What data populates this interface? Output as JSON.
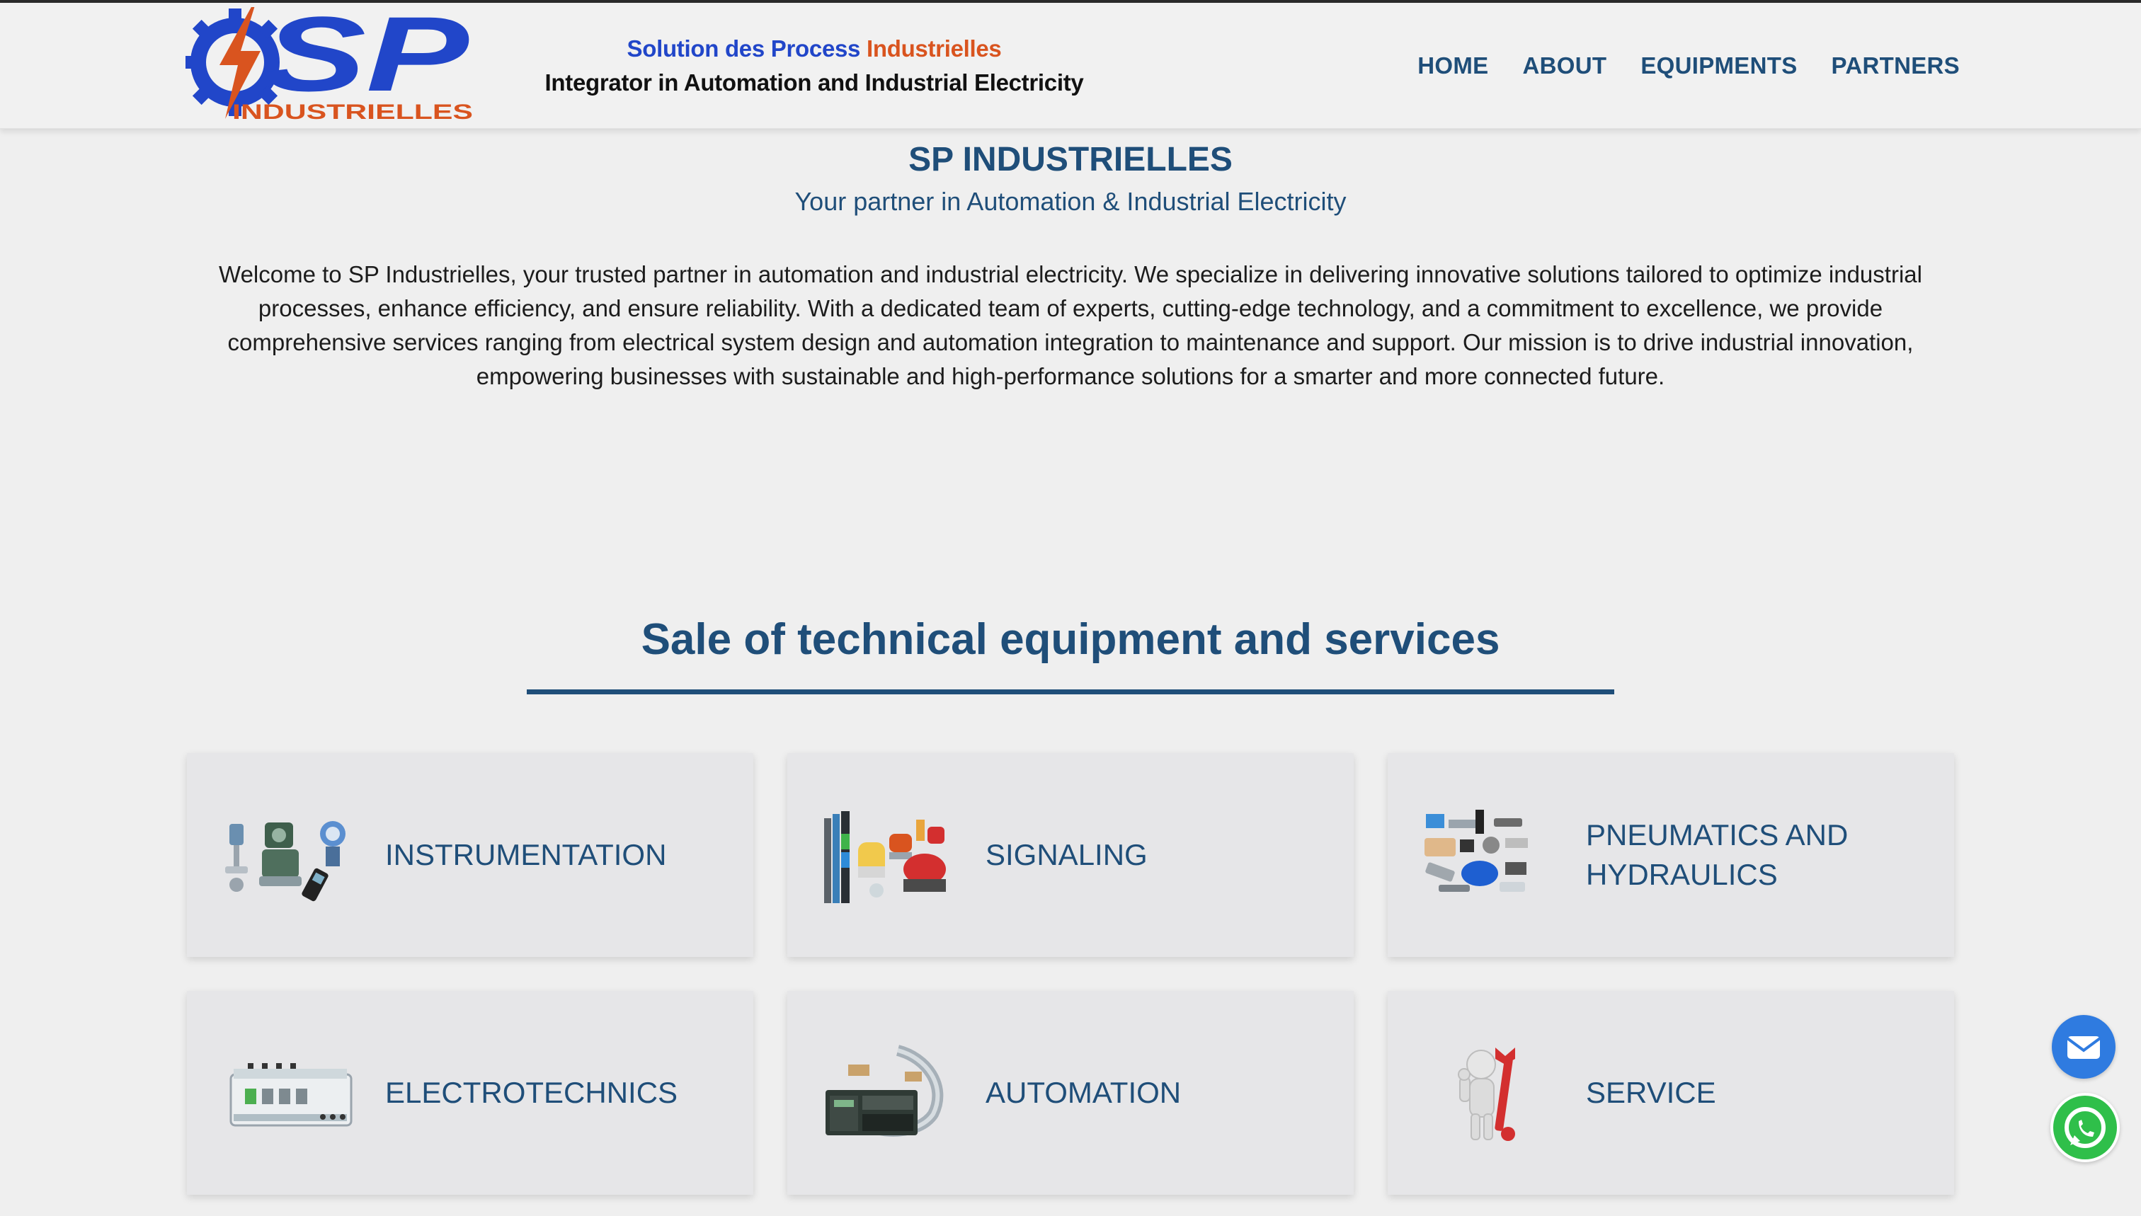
{
  "header": {
    "logo": {
      "text_main": "SP",
      "text_sub": "INDUSTRIELLES"
    },
    "tagline": {
      "part1": "Solution des Process",
      "part2": "Industrielles",
      "line2": "Integrator in Automation and Industrial Electricity"
    },
    "nav": [
      {
        "label": "HOME"
      },
      {
        "label": "ABOUT"
      },
      {
        "label": "EQUIPMENTS"
      },
      {
        "label": "PARTNERS"
      }
    ]
  },
  "hero": {
    "title": "SP INDUSTRIELLES",
    "subtitle": "Your partner in Automation & Industrial Electricity",
    "intro": "Welcome to SP Industrielles, your trusted partner in automation and industrial electricity. We specialize in delivering innovative solutions tailored to optimize industrial processes, enhance efficiency, and ensure reliability. With a dedicated team of experts, cutting-edge technology, and a commitment to excellence, we provide comprehensive services ranging from electrical system design and automation integration to maintenance and support. Our mission is to drive industrial innovation, empowering businesses with sustainable and high-performance solutions for a smarter and more connected future."
  },
  "services": {
    "title": "Sale of technical equipment and services",
    "cards": [
      {
        "label": "INSTRUMENTATION",
        "icon": "instrumentation-icon"
      },
      {
        "label": "SIGNALING",
        "icon": "signaling-icon"
      },
      {
        "label": "PNEUMATICS AND HYDRAULICS",
        "icon": "pneumatics-icon"
      },
      {
        "label": "ELECTROTECHNICS",
        "icon": "electrotechnics-icon"
      },
      {
        "label": "AUTOMATION",
        "icon": "automation-icon"
      },
      {
        "label": "SERVICE",
        "icon": "service-icon"
      }
    ]
  },
  "floating": [
    {
      "icon": "email-icon",
      "color": "#2f7be0"
    },
    {
      "icon": "whatsapp-icon",
      "color": "#2fbf4a"
    }
  ],
  "colors": {
    "brand_blue": "#1f4e79",
    "logo_blue": "#2146c9",
    "logo_orange": "#d9541f"
  }
}
